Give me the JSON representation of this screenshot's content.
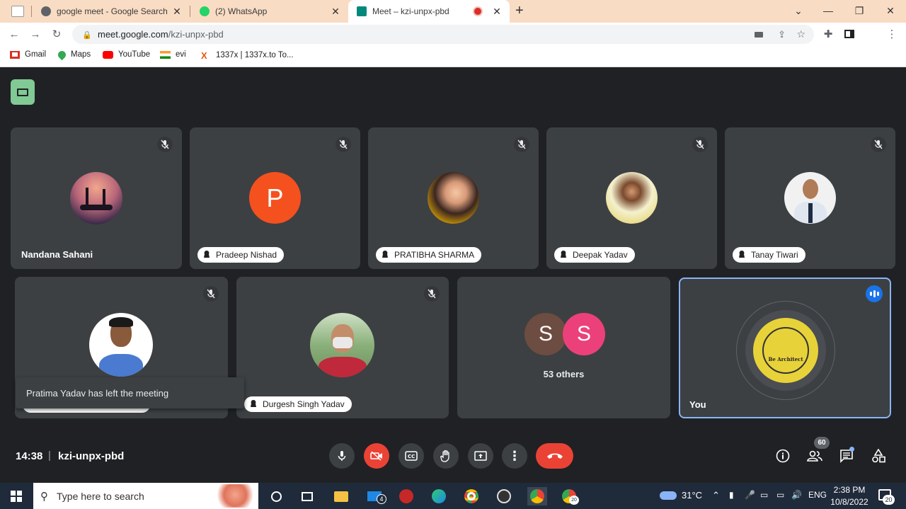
{
  "browser": {
    "tabs": [
      {
        "title": "google meet - Google Search",
        "active": false
      },
      {
        "title": "(2) WhatsApp",
        "active": false
      },
      {
        "title": "Meet – kzi-unpx-pbd",
        "active": true
      }
    ],
    "new_tab": "+",
    "url_host": "meet.google.com",
    "url_path": "/kzi-unpx-pbd",
    "bookmarks": [
      "Gmail",
      "Maps",
      "YouTube",
      "evi",
      "1337x | 1337x.to To..."
    ]
  },
  "meet": {
    "participants_row1": [
      {
        "name": "Nandana Sahani",
        "chip": false,
        "avatar": "photo-silhouette"
      },
      {
        "name": "Pradeep Nishad",
        "chip": true,
        "avatar": "letter",
        "letter": "P",
        "color": "#f4511e"
      },
      {
        "name": "PRATIBHA SHARMA",
        "chip": true,
        "avatar": "photo"
      },
      {
        "name": "Deepak Yadav",
        "chip": true,
        "avatar": "photo"
      },
      {
        "name": "Tanay Tiwari",
        "chip": true,
        "avatar": "photo"
      }
    ],
    "participant_row2_1": {
      "name": ""
    },
    "participant_row2_2": {
      "name": "Durgesh Singh Yadav"
    },
    "others": {
      "letters": [
        "S",
        "S"
      ],
      "label": "53 others"
    },
    "you": {
      "label": "You",
      "logo_text": "Be Architect"
    },
    "toast": "Pratima Yadav has left the meeting",
    "time": "14:38",
    "separator": "|",
    "meeting_code": "kzi-unpx-pbd",
    "people_count": "60"
  },
  "taskbar": {
    "search_placeholder": "Type here to search",
    "mail_badge": "4",
    "chrome_badge": "20",
    "temperature": "31°C",
    "language": "ENG",
    "clock_time": "2:38 PM",
    "clock_date": "10/8/2022",
    "notif_count": "20"
  },
  "colors": {
    "accent": "#8ab4f8",
    "end_call": "#ea4335",
    "tab_strip": "#f9dcc4"
  }
}
